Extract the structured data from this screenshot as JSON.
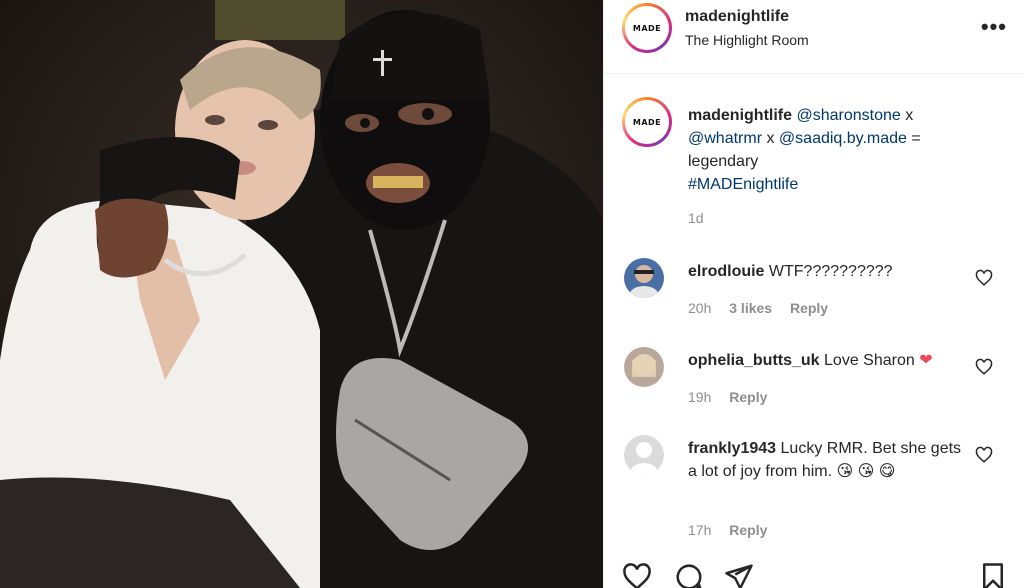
{
  "post": {
    "username": "madenightlife",
    "location": "The Highlight Room",
    "avatar_logo": "MADE",
    "more_label": "•••"
  },
  "caption": {
    "username": "madenightlife",
    "mention1": "@sharonstone",
    "sep1": " x",
    "mention2": "@whatrmr",
    "sep2": " x ",
    "mention3": "@saadiq.by.made",
    "sep3": " =",
    "text": "legendary",
    "hashtag": "#MADEnightlife",
    "age": "1d"
  },
  "comments": [
    {
      "username": "elrodlouie",
      "text": "WTF??????????",
      "time": "20h",
      "likes": "3 likes",
      "reply": "Reply"
    },
    {
      "username": "ophelia_butts_uk",
      "text": "Love Sharon",
      "emoji": "❤",
      "time": "19h",
      "reply": "Reply"
    },
    {
      "username": "frankly1943",
      "text": "Lucky RMR. Bet she gets a lot of joy from him.",
      "emoji": "😘 😘 😋",
      "time": "17h",
      "reply": "Reply"
    }
  ],
  "colors": {
    "link": "#00376b",
    "muted": "#8e8e8e",
    "heart_red": "#ed4956"
  },
  "icons": {
    "like": "heart-icon",
    "comment": "comment-icon",
    "share": "share-icon",
    "save": "bookmark-icon",
    "more": "more-options-icon"
  }
}
